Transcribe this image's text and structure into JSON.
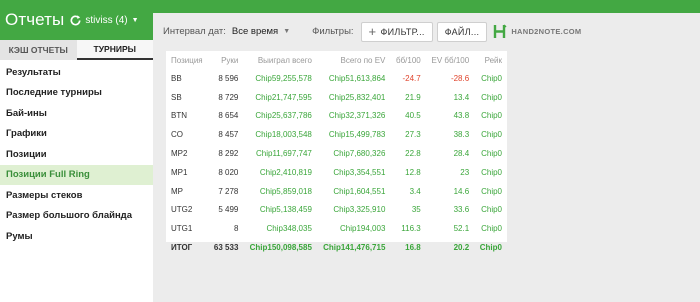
{
  "header": {
    "title": "Отчеты",
    "player": "stiviss (4)"
  },
  "sidebar": {
    "tabs": [
      {
        "label": "КЭШ ОТЧЕТЫ",
        "active": false
      },
      {
        "label": "ТУРНИРЫ",
        "active": true
      }
    ],
    "items": [
      {
        "label": "Результаты",
        "active": false
      },
      {
        "label": "Последние турниры",
        "active": false
      },
      {
        "label": "Бай-ины",
        "active": false
      },
      {
        "label": "Графики",
        "active": false
      },
      {
        "label": "Позиции",
        "active": false
      },
      {
        "label": "Позиции Full Ring",
        "active": true
      },
      {
        "label": "Размеры стеков",
        "active": false
      },
      {
        "label": "Размер большого блайнда",
        "active": false
      },
      {
        "label": "Румы",
        "active": false
      }
    ]
  },
  "toolbar": {
    "date_label": "Интервал дат:",
    "date_value": "Все время",
    "filters_label": "Фильтры:",
    "filter_button": "ФИЛЬТР...",
    "file_button": "ФАЙЛ...",
    "logo_text": "HAND2NOTE.COM"
  },
  "table": {
    "headers": [
      "Позиция",
      "Руки",
      "Выиграл всего",
      "Всего по EV",
      "бб/100",
      "EV бб/100",
      "Рейк"
    ],
    "rows": [
      [
        "BB",
        "8 596",
        "Chip59,255,578",
        "Chip51,613,864",
        "-24.7",
        "-28.6",
        "Chip0"
      ],
      [
        "SB",
        "8 729",
        "Chip21,747,595",
        "Chip25,832,401",
        "21.9",
        "13.4",
        "Chip0"
      ],
      [
        "BTN",
        "8 654",
        "Chip25,637,786",
        "Chip32,371,326",
        "40.5",
        "43.8",
        "Chip0"
      ],
      [
        "CO",
        "8 457",
        "Chip18,003,548",
        "Chip15,499,783",
        "27.3",
        "38.3",
        "Chip0"
      ],
      [
        "MP2",
        "8 292",
        "Chip11,697,747",
        "Chip7,680,326",
        "22.8",
        "28.4",
        "Chip0"
      ],
      [
        "MP1",
        "8 020",
        "Chip2,410,819",
        "Chip3,354,551",
        "12.8",
        "23",
        "Chip0"
      ],
      [
        "MP",
        "7 278",
        "Chip5,859,018",
        "Chip1,604,551",
        "3.4",
        "14.6",
        "Chip0"
      ],
      [
        "UTG2",
        "5 499",
        "Chip5,138,459",
        "Chip3,325,910",
        "35",
        "33.6",
        "Chip0"
      ],
      [
        "UTG1",
        "8",
        "Chip348,035",
        "Chip194,003",
        "116.3",
        "52.1",
        "Chip0"
      ],
      [
        "ИТОГ",
        "63 533",
        "Chip150,098,585",
        "Chip141,476,715",
        "16.8",
        "20.2",
        "Chip0"
      ]
    ]
  },
  "colors": {
    "accent": "#43a843",
    "positive": "#3aa63a",
    "negative": "#e0442c",
    "active_bg": "#dff0d2"
  }
}
